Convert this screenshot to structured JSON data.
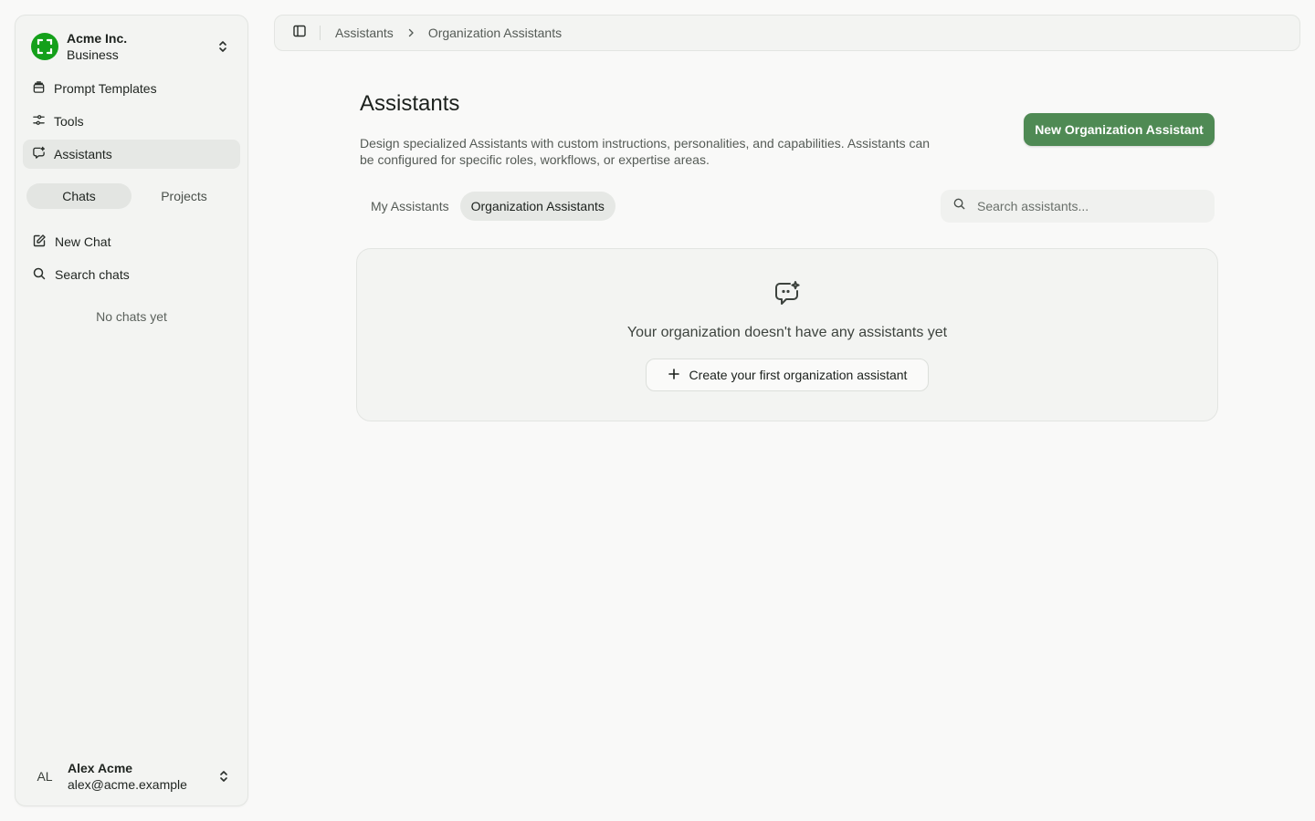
{
  "sidebar": {
    "org": {
      "name": "Acme Inc.",
      "plan": "Business"
    },
    "nav": [
      {
        "label": "Prompt Templates",
        "icon": "template-icon"
      },
      {
        "label": "Tools",
        "icon": "tools-icon"
      },
      {
        "label": "Assistants",
        "icon": "assistant-icon",
        "active": true
      }
    ],
    "segments": [
      {
        "label": "Chats",
        "active": true
      },
      {
        "label": "Projects",
        "active": false
      }
    ],
    "actions": [
      {
        "label": "New Chat",
        "icon": "new-chat-icon"
      },
      {
        "label": "Search chats",
        "icon": "search-icon"
      }
    ],
    "empty_text": "No chats yet",
    "user": {
      "initials": "AL",
      "name": "Alex Acme",
      "email": "alex@acme.example"
    }
  },
  "topbar": {
    "breadcrumb": [
      "Assistants",
      "Organization Assistants"
    ]
  },
  "main": {
    "title": "Assistants",
    "description": "Design specialized Assistants with custom instructions, personalities, and capabilities. Assistants can be configured for specific roles, workflows, or expertise areas.",
    "new_button": "New Organization Assistant",
    "tabs": [
      {
        "label": "My Assistants",
        "active": false
      },
      {
        "label": "Organization Assistants",
        "active": true
      }
    ],
    "search_placeholder": "Search assistants...",
    "empty_state": {
      "message": "Your organization doesn't have any assistants yet",
      "button": "Create your first organization assistant"
    }
  },
  "colors": {
    "accent": "#4f8a54",
    "org_logo": "#14a01a",
    "background": "#f9f9f8"
  }
}
